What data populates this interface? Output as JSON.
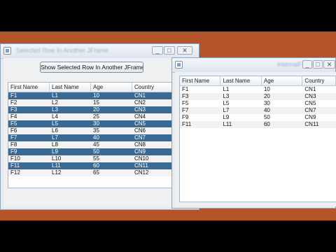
{
  "window1": {
    "title": "Selected Row In Another JFrame",
    "controls": [
      "_",
      "□",
      "✕"
    ],
    "button_label": "Show Selected Row In Another JFrame",
    "table": {
      "columns": [
        "First Name",
        "Last Name",
        "Age",
        "Country"
      ],
      "rows": [
        {
          "cells": [
            "F1",
            "L1",
            "10",
            "CN1"
          ],
          "selected": true
        },
        {
          "cells": [
            "F2",
            "L2",
            "15",
            "CN2"
          ],
          "selected": false
        },
        {
          "cells": [
            "F3",
            "L3",
            "20",
            "CN3"
          ],
          "selected": true
        },
        {
          "cells": [
            "F4",
            "L4",
            "25",
            "CN4"
          ],
          "selected": false
        },
        {
          "cells": [
            "F5",
            "L5",
            "30",
            "CN5"
          ],
          "selected": true
        },
        {
          "cells": [
            "F6",
            "L6",
            "35",
            "CN6"
          ],
          "selected": false
        },
        {
          "cells": [
            "F7",
            "L7",
            "40",
            "CN7"
          ],
          "selected": true
        },
        {
          "cells": [
            "F8",
            "L8",
            "45",
            "CN8"
          ],
          "selected": false
        },
        {
          "cells": [
            "F9",
            "L9",
            "50",
            "CN9"
          ],
          "selected": true
        },
        {
          "cells": [
            "F10",
            "L10",
            "55",
            "CN10"
          ],
          "selected": false
        },
        {
          "cells": [
            "F11",
            "L11",
            "60",
            "CN11"
          ],
          "selected": true
        },
        {
          "cells": [
            "F12",
            "L12",
            "65",
            "CN12"
          ],
          "selected": false
        }
      ]
    }
  },
  "window2": {
    "title": "InternalFrame",
    "controls": [
      "_",
      "□",
      "✕"
    ],
    "table": {
      "columns": [
        "First Name",
        "Last Name",
        "Age",
        "Country"
      ],
      "rows": [
        {
          "cells": [
            "F1",
            "L1",
            "10",
            "CN1"
          ]
        },
        {
          "cells": [
            "F3",
            "L3",
            "20",
            "CN3"
          ]
        },
        {
          "cells": [
            "F5",
            "L5",
            "30",
            "CN5"
          ]
        },
        {
          "cells": [
            "F7",
            "L7",
            "40",
            "CN7"
          ]
        },
        {
          "cells": [
            "F9",
            "L9",
            "50",
            "CN9"
          ]
        },
        {
          "cells": [
            "F11",
            "L11",
            "60",
            "CN11"
          ]
        }
      ]
    }
  },
  "colors": {
    "desktop": "#b4542a",
    "selection": "#3a6a94",
    "letterbox": "#000000"
  }
}
